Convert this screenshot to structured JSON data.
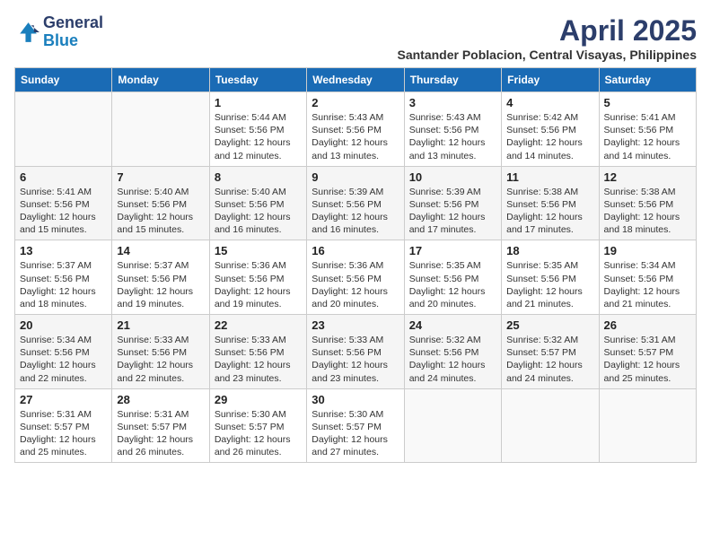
{
  "header": {
    "logo_general": "General",
    "logo_blue": "Blue",
    "month_year": "April 2025",
    "location": "Santander Poblacion, Central Visayas, Philippines"
  },
  "days_of_week": [
    "Sunday",
    "Monday",
    "Tuesday",
    "Wednesday",
    "Thursday",
    "Friday",
    "Saturday"
  ],
  "weeks": [
    [
      {
        "day": "",
        "text": ""
      },
      {
        "day": "",
        "text": ""
      },
      {
        "day": "1",
        "text": "Sunrise: 5:44 AM\nSunset: 5:56 PM\nDaylight: 12 hours and 12 minutes."
      },
      {
        "day": "2",
        "text": "Sunrise: 5:43 AM\nSunset: 5:56 PM\nDaylight: 12 hours and 13 minutes."
      },
      {
        "day": "3",
        "text": "Sunrise: 5:43 AM\nSunset: 5:56 PM\nDaylight: 12 hours and 13 minutes."
      },
      {
        "day": "4",
        "text": "Sunrise: 5:42 AM\nSunset: 5:56 PM\nDaylight: 12 hours and 14 minutes."
      },
      {
        "day": "5",
        "text": "Sunrise: 5:41 AM\nSunset: 5:56 PM\nDaylight: 12 hours and 14 minutes."
      }
    ],
    [
      {
        "day": "6",
        "text": "Sunrise: 5:41 AM\nSunset: 5:56 PM\nDaylight: 12 hours and 15 minutes."
      },
      {
        "day": "7",
        "text": "Sunrise: 5:40 AM\nSunset: 5:56 PM\nDaylight: 12 hours and 15 minutes."
      },
      {
        "day": "8",
        "text": "Sunrise: 5:40 AM\nSunset: 5:56 PM\nDaylight: 12 hours and 16 minutes."
      },
      {
        "day": "9",
        "text": "Sunrise: 5:39 AM\nSunset: 5:56 PM\nDaylight: 12 hours and 16 minutes."
      },
      {
        "day": "10",
        "text": "Sunrise: 5:39 AM\nSunset: 5:56 PM\nDaylight: 12 hours and 17 minutes."
      },
      {
        "day": "11",
        "text": "Sunrise: 5:38 AM\nSunset: 5:56 PM\nDaylight: 12 hours and 17 minutes."
      },
      {
        "day": "12",
        "text": "Sunrise: 5:38 AM\nSunset: 5:56 PM\nDaylight: 12 hours and 18 minutes."
      }
    ],
    [
      {
        "day": "13",
        "text": "Sunrise: 5:37 AM\nSunset: 5:56 PM\nDaylight: 12 hours and 18 minutes."
      },
      {
        "day": "14",
        "text": "Sunrise: 5:37 AM\nSunset: 5:56 PM\nDaylight: 12 hours and 19 minutes."
      },
      {
        "day": "15",
        "text": "Sunrise: 5:36 AM\nSunset: 5:56 PM\nDaylight: 12 hours and 19 minutes."
      },
      {
        "day": "16",
        "text": "Sunrise: 5:36 AM\nSunset: 5:56 PM\nDaylight: 12 hours and 20 minutes."
      },
      {
        "day": "17",
        "text": "Sunrise: 5:35 AM\nSunset: 5:56 PM\nDaylight: 12 hours and 20 minutes."
      },
      {
        "day": "18",
        "text": "Sunrise: 5:35 AM\nSunset: 5:56 PM\nDaylight: 12 hours and 21 minutes."
      },
      {
        "day": "19",
        "text": "Sunrise: 5:34 AM\nSunset: 5:56 PM\nDaylight: 12 hours and 21 minutes."
      }
    ],
    [
      {
        "day": "20",
        "text": "Sunrise: 5:34 AM\nSunset: 5:56 PM\nDaylight: 12 hours and 22 minutes."
      },
      {
        "day": "21",
        "text": "Sunrise: 5:33 AM\nSunset: 5:56 PM\nDaylight: 12 hours and 22 minutes."
      },
      {
        "day": "22",
        "text": "Sunrise: 5:33 AM\nSunset: 5:56 PM\nDaylight: 12 hours and 23 minutes."
      },
      {
        "day": "23",
        "text": "Sunrise: 5:33 AM\nSunset: 5:56 PM\nDaylight: 12 hours and 23 minutes."
      },
      {
        "day": "24",
        "text": "Sunrise: 5:32 AM\nSunset: 5:56 PM\nDaylight: 12 hours and 24 minutes."
      },
      {
        "day": "25",
        "text": "Sunrise: 5:32 AM\nSunset: 5:57 PM\nDaylight: 12 hours and 24 minutes."
      },
      {
        "day": "26",
        "text": "Sunrise: 5:31 AM\nSunset: 5:57 PM\nDaylight: 12 hours and 25 minutes."
      }
    ],
    [
      {
        "day": "27",
        "text": "Sunrise: 5:31 AM\nSunset: 5:57 PM\nDaylight: 12 hours and 25 minutes."
      },
      {
        "day": "28",
        "text": "Sunrise: 5:31 AM\nSunset: 5:57 PM\nDaylight: 12 hours and 26 minutes."
      },
      {
        "day": "29",
        "text": "Sunrise: 5:30 AM\nSunset: 5:57 PM\nDaylight: 12 hours and 26 minutes."
      },
      {
        "day": "30",
        "text": "Sunrise: 5:30 AM\nSunset: 5:57 PM\nDaylight: 12 hours and 27 minutes."
      },
      {
        "day": "",
        "text": ""
      },
      {
        "day": "",
        "text": ""
      },
      {
        "day": "",
        "text": ""
      }
    ]
  ]
}
